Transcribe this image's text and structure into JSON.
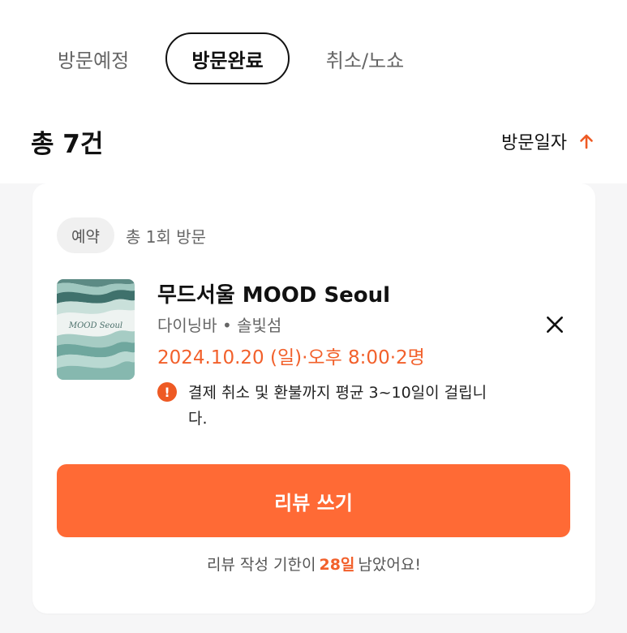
{
  "tabs": [
    {
      "label": "방문예정",
      "active": false
    },
    {
      "label": "방문완료",
      "active": true
    },
    {
      "label": "취소/노쇼",
      "active": false
    }
  ],
  "summary": {
    "total_label": "총 7건",
    "sort_label": "방문일자",
    "sort_icon": "arrow-up-icon",
    "sort_icon_color": "#ee5a24"
  },
  "reservation": {
    "badge": "예약",
    "visit_count": "총 1회 방문",
    "restaurant_name": "무드서울 MOOD Seoul",
    "category": "다이닝바 • 솔빛섬",
    "datetime": "2024.10.20 (일)·오후 8:00·2명",
    "notice": "결제 취소 및 환불까지 평균 3~10일이 걸립니다.",
    "notice_icon": "info-icon",
    "close_icon": "close-icon",
    "thumbnail_text": "MOOD Seoul",
    "review_button": "리뷰 쓰기",
    "deadline_prefix": "리뷰 작성 기한이",
    "deadline_days": "28일",
    "deadline_suffix": "남았어요!"
  },
  "colors": {
    "accent": "#ff6a35",
    "accent_text": "#f2602b",
    "background": "#f6f6f7",
    "card": "#ffffff"
  }
}
